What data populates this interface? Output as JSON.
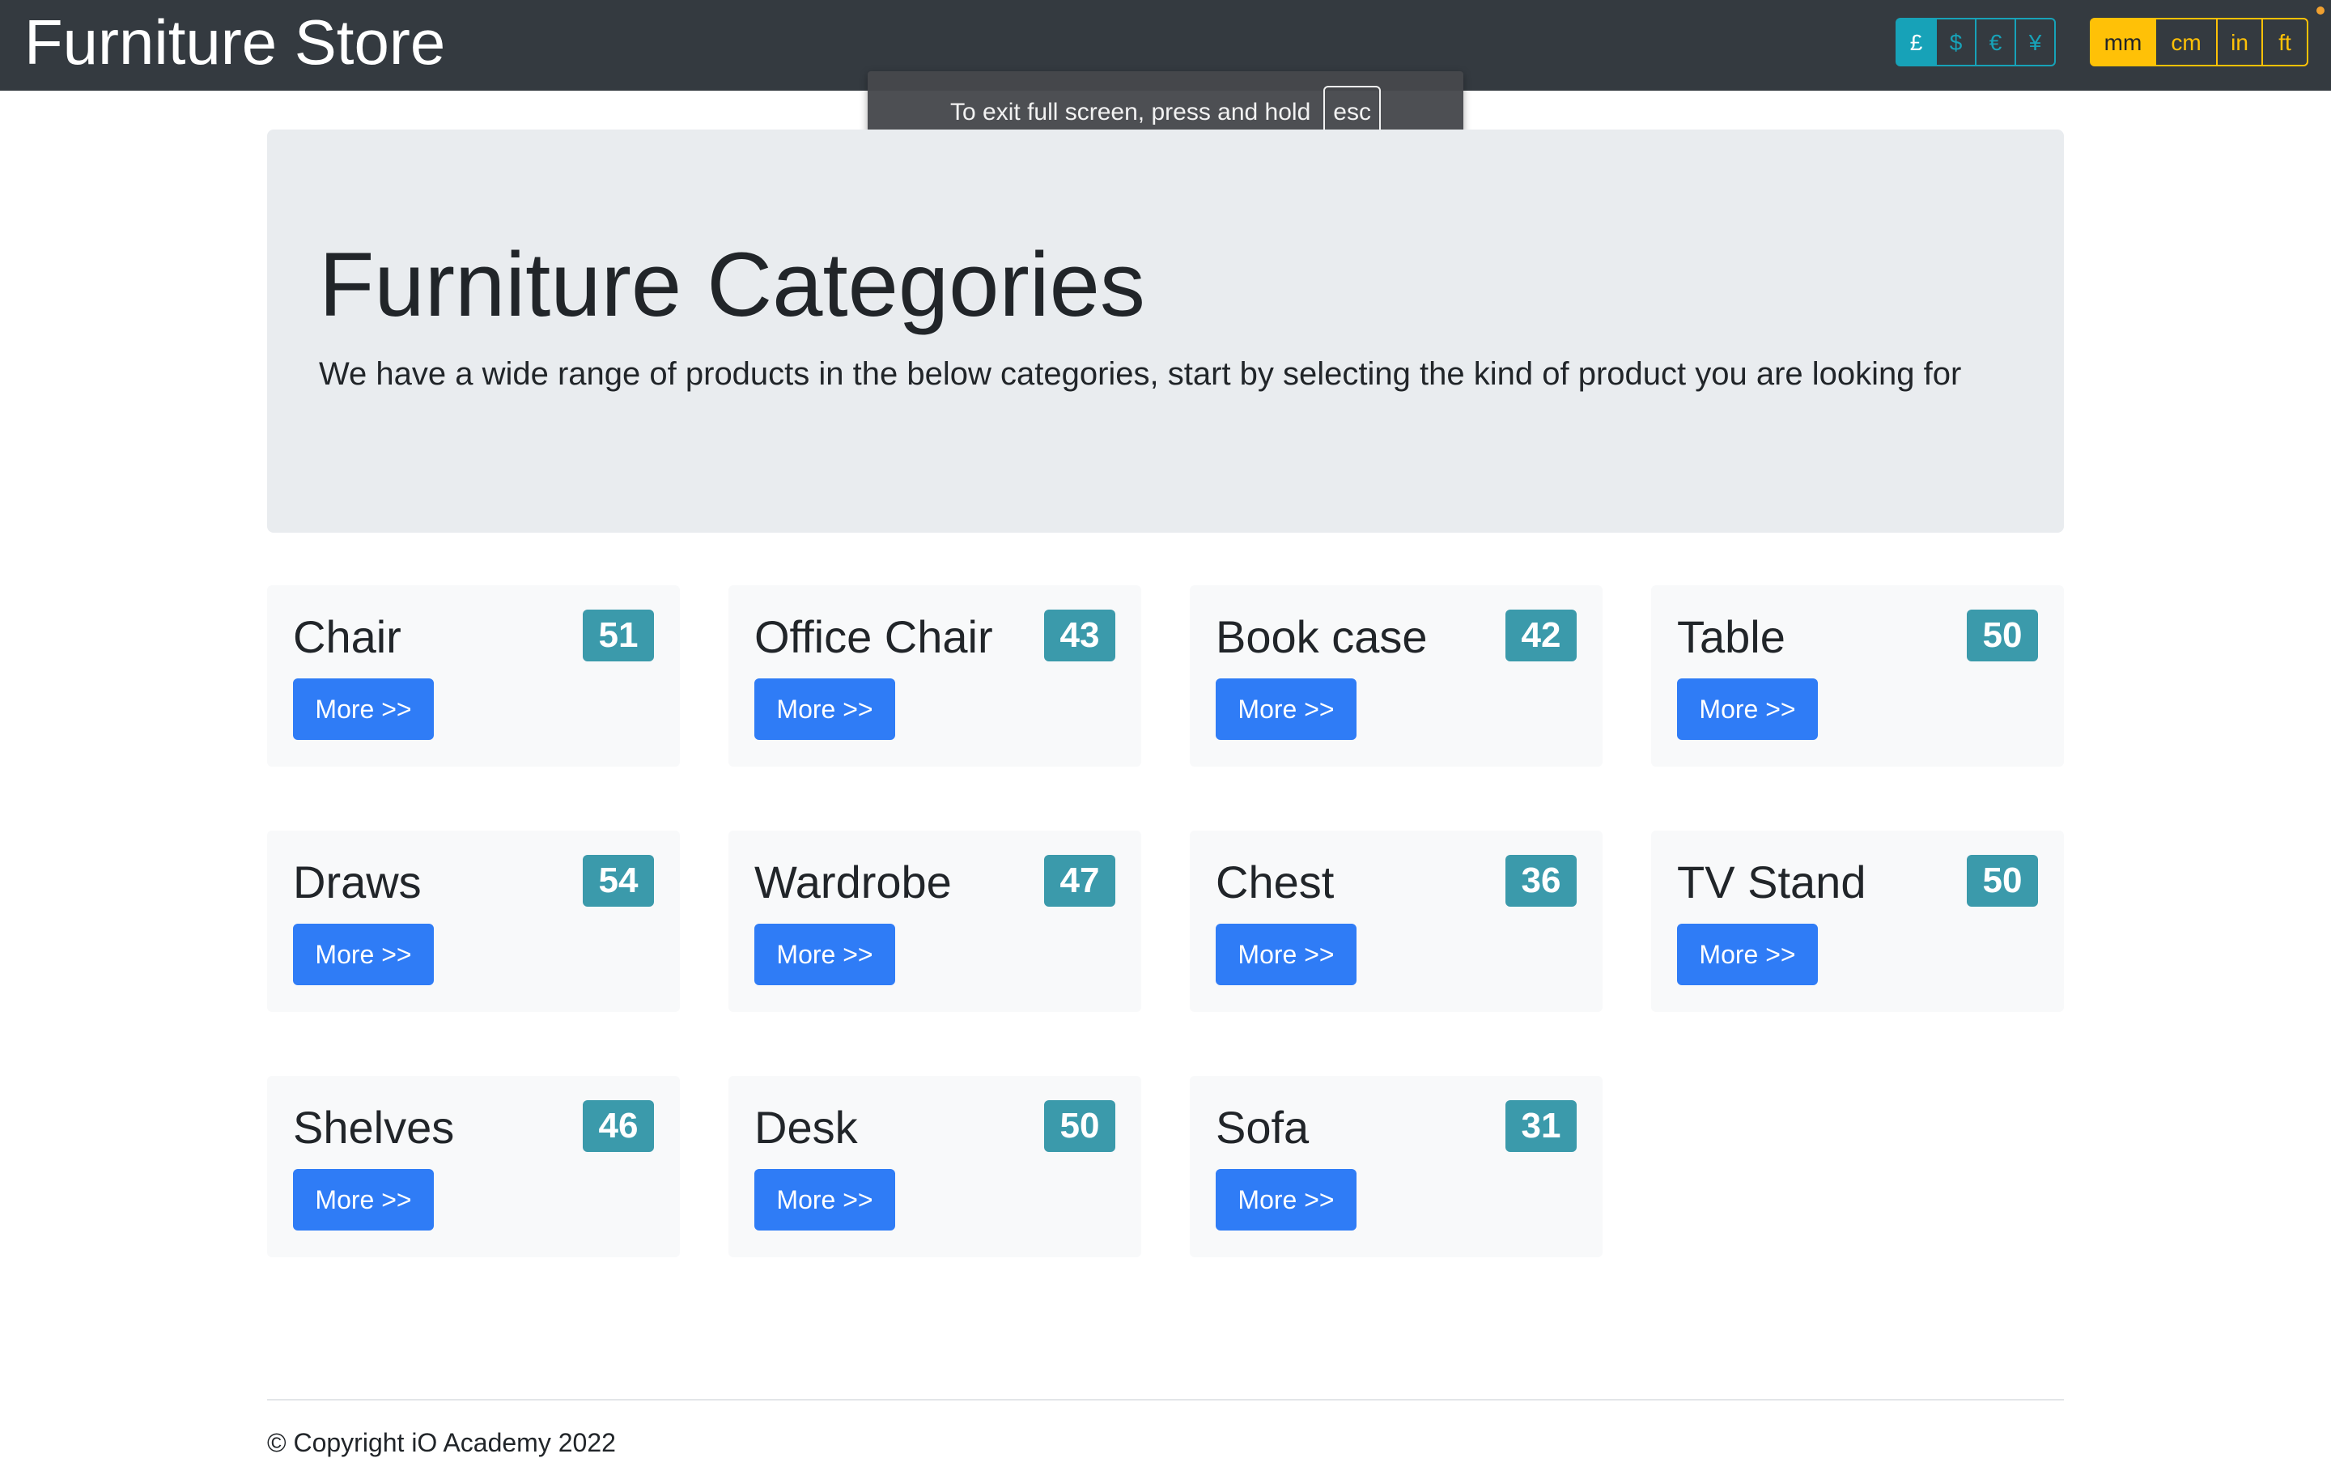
{
  "navbar": {
    "brand": "Furniture Store",
    "currencies": [
      "£",
      "$",
      "€",
      "¥"
    ],
    "active_currency": "£",
    "units": [
      "mm",
      "cm",
      "in",
      "ft"
    ],
    "active_unit": "mm"
  },
  "toast": {
    "message": "To exit full screen, press and hold",
    "key": "esc"
  },
  "jumbotron": {
    "title": "Furniture Categories",
    "lead": "We have a wide range of products in the below categories, start by selecting the kind of product you are looking for"
  },
  "categories": [
    {
      "name": "Chair",
      "count": "51",
      "button": "More >>"
    },
    {
      "name": "Office Chair",
      "count": "43",
      "button": "More >>"
    },
    {
      "name": "Book case",
      "count": "42",
      "button": "More >>"
    },
    {
      "name": "Table",
      "count": "50",
      "button": "More >>"
    },
    {
      "name": "Draws",
      "count": "54",
      "button": "More >>"
    },
    {
      "name": "Wardrobe",
      "count": "47",
      "button": "More >>"
    },
    {
      "name": "Chest",
      "count": "36",
      "button": "More >>"
    },
    {
      "name": "TV Stand",
      "count": "50",
      "button": "More >>"
    },
    {
      "name": "Shelves",
      "count": "46",
      "button": "More >>"
    },
    {
      "name": "Desk",
      "count": "50",
      "button": "More >>"
    },
    {
      "name": "Sofa",
      "count": "31",
      "button": "More >>"
    }
  ],
  "footer": {
    "copyright": "© Copyright iO Academy 2022"
  },
  "colors": {
    "navbar_bg": "#343a40",
    "currency_accent": "#17a2b8",
    "unit_accent": "#ffc107",
    "primary_button": "#2f7cf6",
    "badge": "#3b9aab"
  }
}
